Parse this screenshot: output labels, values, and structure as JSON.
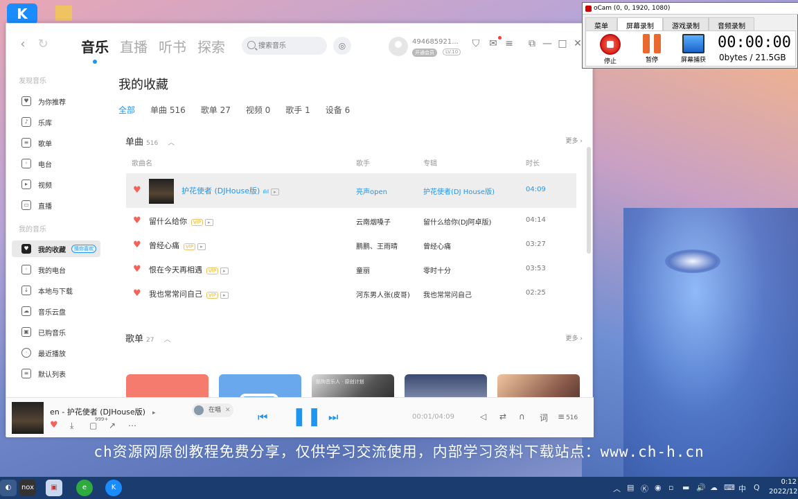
{
  "desktop": {
    "kugou_icon_letter": "K"
  },
  "app": {
    "top_tabs": [
      "音乐",
      "直播",
      "听书",
      "探索"
    ],
    "search": {
      "placeholder": "搜索音乐"
    },
    "user": {
      "name": "494685921...",
      "vip_badge": "开通会员",
      "level": "LV.10"
    },
    "sidebar": {
      "section_discover": "发现音乐",
      "discover_items": [
        "为你推荐",
        "乐库",
        "歌单",
        "电台",
        "视频",
        "直播"
      ],
      "section_mine": "我的音乐",
      "mine_items": [
        "我的收藏",
        "我的电台",
        "本地与下载",
        "音乐云盘",
        "已购音乐",
        "最近播放",
        "默认列表"
      ],
      "active_tag": "猜你喜欢"
    },
    "main": {
      "title": "我的收藏",
      "subtabs": [
        "全部",
        "单曲 516",
        "歌单 27",
        "视频 0",
        "歌手 1",
        "设备 6"
      ],
      "songs_section": {
        "label": "单曲",
        "count": "516",
        "more": "更多"
      },
      "columns": {
        "name": "歌曲名",
        "artist": "歌手",
        "album": "专辑",
        "duration": "时长"
      },
      "songs": [
        {
          "title": "护花使者 (DJHouse版)",
          "artist": "亮声open",
          "album": "护花使者(DJ House版)",
          "duration": "04:09"
        },
        {
          "title": "留什么给你",
          "artist": "云南烟嗓子",
          "album": "留什么给你(DJ阿卓版)",
          "duration": "04:14"
        },
        {
          "title": "曾经心痛",
          "artist": "鹏鹏、王雨晴",
          "album": "曾经心痛",
          "duration": "03:27"
        },
        {
          "title": "恨在今天再相遇",
          "artist": "童丽",
          "album": "零时十分",
          "duration": "03:53"
        },
        {
          "title": "我也常常问自己",
          "artist": "河东男人张(皮哥)",
          "album": "我也常常问自己",
          "duration": "02:25"
        }
      ],
      "vip_tag": "VIP",
      "playlist_section": {
        "label": "歌单",
        "count": "27",
        "more": "更多"
      },
      "playlist_card_text": "酷狗音乐人 · 原创计划"
    },
    "player": {
      "now_playing": "en - 护花使者 (DJHouse版)",
      "singing_label": "在唱",
      "comments_count": "999+",
      "time": "00:01/04:09",
      "lyrics_label": "词",
      "queue_count": "516"
    }
  },
  "ocam": {
    "title": "oCam (0, 0, 1920, 1080)",
    "menu": [
      "菜单",
      "屏幕录制",
      "游戏录制",
      "音频录制"
    ],
    "buttons": [
      "停止",
      "暂停",
      "屏幕捕获"
    ],
    "timer": "00:00:00",
    "size": "0bytes / 21.5GB"
  },
  "caption": "ch资源网原创教程免费分享，仅供学习交流使用，内部学习资料下载站点：www.ch-h.cn",
  "taskbar": {
    "tray_ime": "中",
    "clock_time": "0:12",
    "clock_date": "2022/12"
  }
}
